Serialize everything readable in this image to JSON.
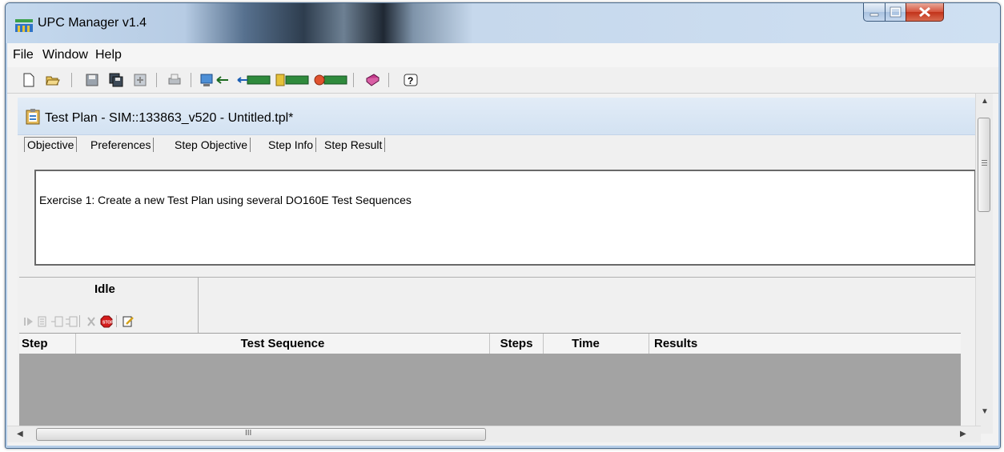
{
  "app": {
    "title": "UPC Manager v1.4"
  },
  "menu": {
    "items": [
      "File",
      "Window",
      "Help"
    ]
  },
  "toolbar": {
    "buttons": [
      "new-icon",
      "open-icon",
      "save-icon",
      "save-all-icon",
      "export-icon",
      "print-icon",
      "connect-icon",
      "download-icon",
      "upload-icon",
      "sync-icon",
      "help-book-icon",
      "context-help-icon"
    ]
  },
  "document": {
    "title": "Test Plan - SIM::133863_v520 - Untitled.tpl*",
    "tabs": [
      "Objective",
      "Preferences",
      "Step Objective",
      "Step Info",
      "Step Result"
    ],
    "active_tab": "Objective",
    "objective_text": "Exercise 1:  Create a new Test Plan using several  DO160E Test Sequences"
  },
  "status": {
    "state": "Idle"
  },
  "grid": {
    "columns": [
      "Step",
      "Test Sequence",
      "Steps",
      "Time",
      "Results"
    ]
  },
  "scrollbars": {
    "h_grip": "III"
  },
  "colors": {
    "grid_body": "#a3a3a3",
    "header_bg": "#d3e2f2",
    "close_button": "#c2321a"
  }
}
